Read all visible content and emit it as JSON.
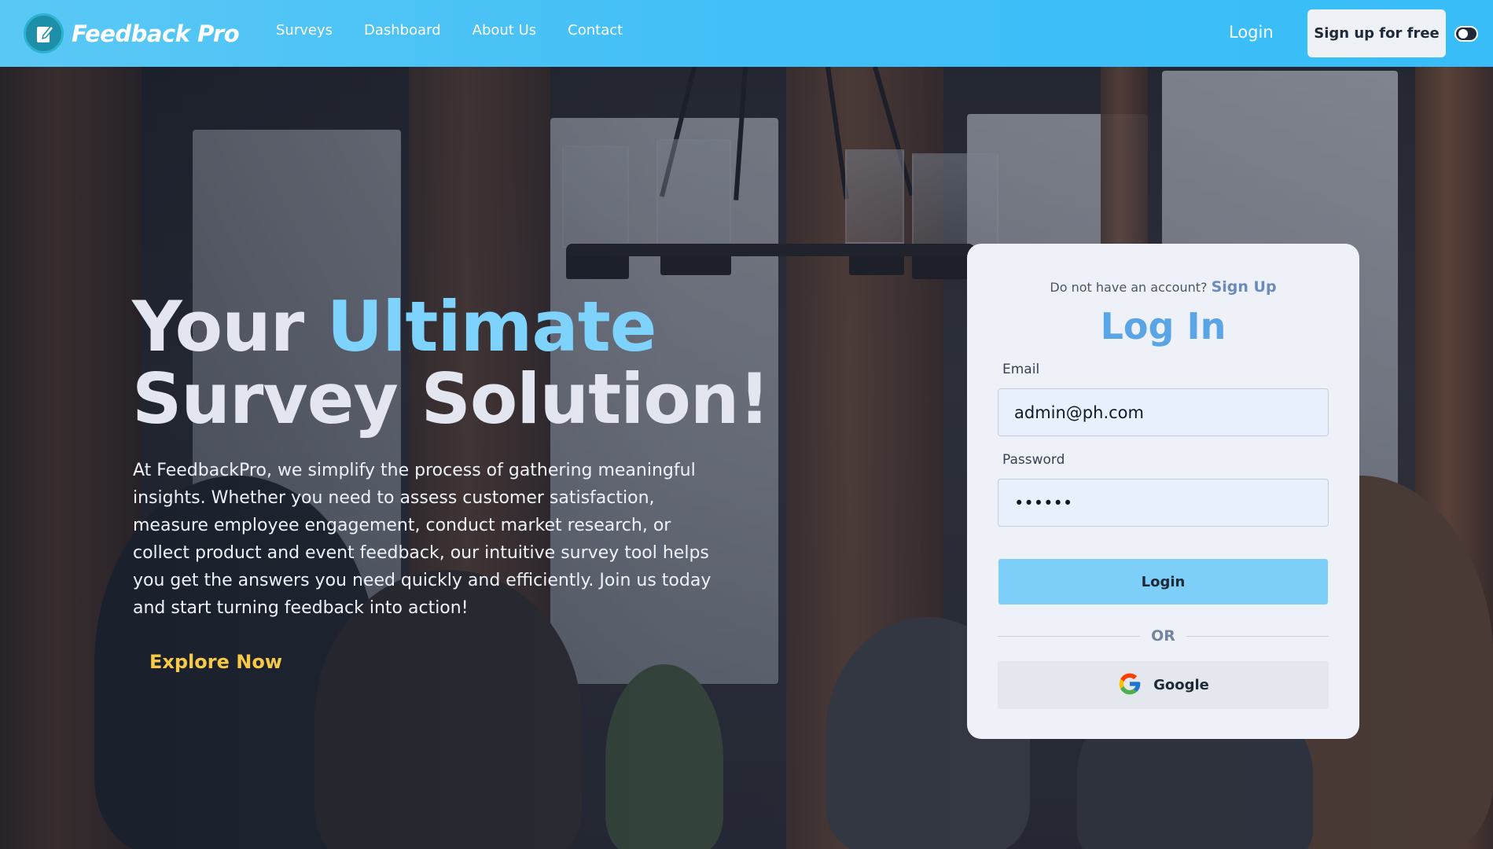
{
  "brand": {
    "name": "Feedback Pro",
    "colors": {
      "navbar": "#38bdf8",
      "accent": "#7dd3fc",
      "explore": "#f7c948",
      "login_button": "#7dcff9",
      "card_title": "#5aa5e6"
    }
  },
  "nav": {
    "links": [
      "Surveys",
      "Dashboard",
      "About Us",
      "Contact"
    ],
    "login": "Login",
    "signup": "Sign up for free",
    "theme_toggle_icon": "toggle-icon"
  },
  "hero": {
    "headline_part1": "Your ",
    "headline_accent": "Ultimate",
    "headline_part2": " Survey Solution!",
    "description": "At FeedbackPro, we simplify the process of gathering meaningful insights. Whether you need to assess customer satisfaction, measure employee engagement, conduct market research, or collect product and event feedback, our intuitive survey tool helps you get the answers you need quickly and efficiently. Join us today and start turning feedback into action!",
    "cta": "Explore Now"
  },
  "login_card": {
    "no_account_text": "Do not have an account?",
    "signup_link": "Sign Up",
    "title": "Log In",
    "email_label": "Email",
    "email_value": "admin@ph.com",
    "password_label": "Password",
    "password_value": "••••••",
    "login_button": "Login",
    "or_text": "OR",
    "google_button": "Google"
  }
}
